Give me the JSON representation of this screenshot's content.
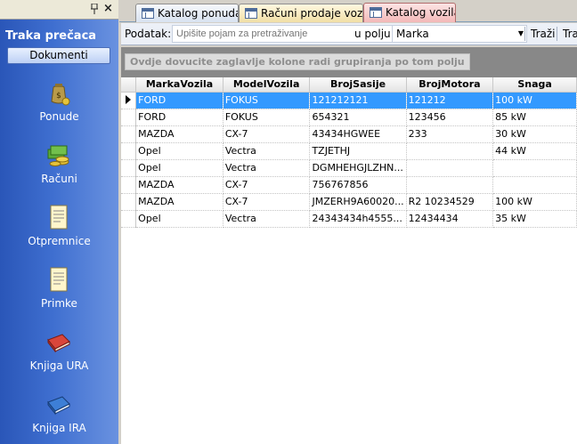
{
  "sidebar": {
    "pin_glyph": "↕",
    "close_glyph": "×",
    "title": "Traka prečaca",
    "docs_button": "Dokumenti",
    "items": [
      {
        "label": "Ponude",
        "icon": "money-bag-icon"
      },
      {
        "label": "Računi",
        "icon": "coins-icon"
      },
      {
        "label": "Otpremnice",
        "icon": "document-icon"
      },
      {
        "label": "Primke",
        "icon": "document-icon"
      },
      {
        "label": "Knjiga URA",
        "icon": "red-book-icon"
      },
      {
        "label": "Knjiga IRA",
        "icon": "blue-book-icon"
      }
    ]
  },
  "tabs": [
    {
      "label": "Katalog ponuda",
      "icon": "form-icon"
    },
    {
      "label": "Računi prodaje vozila",
      "icon": "form-icon"
    },
    {
      "label": "Katalog vozila",
      "icon": "form-icon"
    }
  ],
  "search": {
    "label": "Podatak:",
    "placeholder": "Upišite pojam za pretraživanje",
    "field_label": "u polju:",
    "field_value": "Marka",
    "button": "Traži",
    "button2": "Tra"
  },
  "grouping_hint": "Ovdje dovucite zaglavlje kolone radi grupiranja po tom polju",
  "grid": {
    "columns": [
      "MarkaVozila",
      "ModelVozila",
      "BrojSasije",
      "BrojMotora",
      "Snaga"
    ],
    "rows": [
      [
        "FORD",
        "FOKUS",
        "121212121",
        "121212",
        "100 kW"
      ],
      [
        "FORD",
        "FOKUS",
        "654321",
        "123456",
        "85 kW"
      ],
      [
        "MAZDA",
        "CX-7",
        "43434HGWEE",
        "233",
        "30 kW"
      ],
      [
        "Opel",
        "Vectra",
        "TZJETHJ",
        "",
        "44 kW"
      ],
      [
        "Opel",
        "Vectra",
        "DGMHEHGJLZHN...",
        "",
        ""
      ],
      [
        "MAZDA",
        "CX-7",
        "756767856",
        "",
        ""
      ],
      [
        "MAZDA",
        "CX-7",
        "JMZERH9A60020...",
        "R2 10234529",
        "100 kW"
      ],
      [
        "Opel",
        "Vectra",
        "24343434h4555...",
        "12434434",
        "35 kW"
      ]
    ],
    "selected_row": 0
  }
}
